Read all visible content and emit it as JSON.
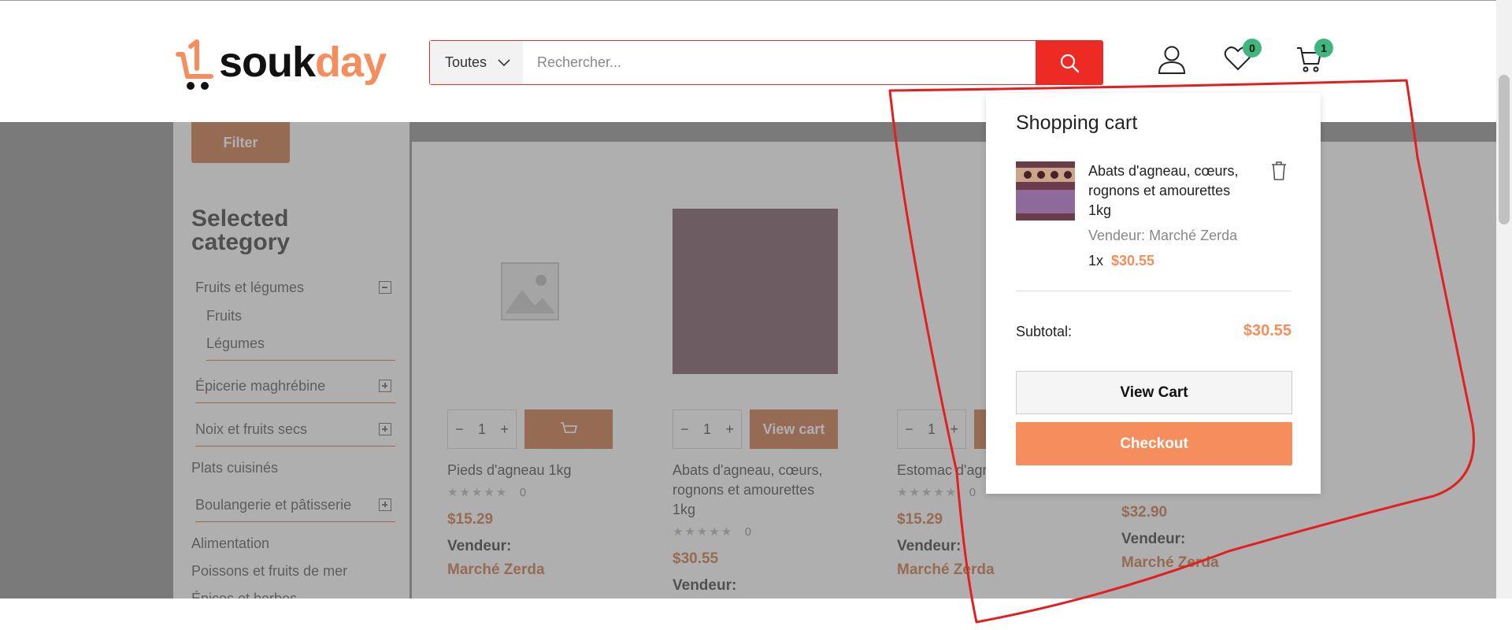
{
  "header": {
    "logo_part1": "souk",
    "logo_part2": "day",
    "search": {
      "category": "Toutes",
      "placeholder": "Rechercher..."
    },
    "wishlist_count": "0",
    "cart_count": "1"
  },
  "sidebar": {
    "filter_label": "Filter",
    "selected_title": "Selected category",
    "categories": [
      "Fruits et légumes",
      "Fruits",
      "Légumes",
      "Épicerie maghrébine",
      "Noix et fruits secs",
      "Plats cuisinés",
      "Boulangerie et pâtisserie",
      "Alimentation",
      "Poissons et fruits de mer",
      "Épices et herbes"
    ]
  },
  "products": [
    {
      "name": "Pieds d'agneau 1kg",
      "rating": "0",
      "price": "$15.29",
      "vendor_label": "Vendeur:",
      "vendor": "Marché Zerda",
      "qty": "1",
      "button": ""
    },
    {
      "name": "Abats d'agneau, cœurs, rognons et amourettes 1kg",
      "rating": "0",
      "price": "$30.55",
      "vendor_label": "Vendeur:",
      "vendor": "",
      "qty": "1",
      "button": "View cart"
    },
    {
      "name": "Estomac d'agn",
      "rating": "0",
      "price": "$15.29",
      "vendor_label": "Vendeur:",
      "vendor": "Marché Zerda",
      "qty": "1",
      "button": ""
    },
    {
      "name": "",
      "rating": "",
      "price": "$32.90",
      "vendor_label": "Vendeur:",
      "vendor": "Marché Zerda",
      "qty": "",
      "button": ""
    }
  ],
  "cart": {
    "title": "Shopping cart",
    "item_name": "Abats d'agneau, cœurs, rognons et amourettes 1kg",
    "vendor": "Vendeur: Marché Zerda",
    "qty": "1x",
    "item_price": "$30.55",
    "subtotal_label": "Subtotal:",
    "subtotal_value": "$30.55",
    "view_cart": "View Cart",
    "checkout": "Checkout"
  },
  "colors": {
    "accent": "#f58d5c",
    "search_red": "#ee2a24",
    "badge": "#3fb67e",
    "annotation": "#e32020"
  }
}
